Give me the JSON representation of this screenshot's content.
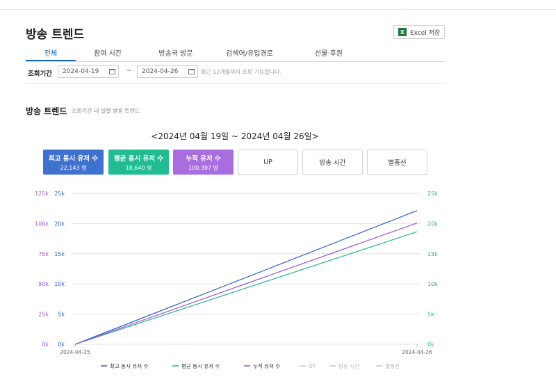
{
  "header": {
    "title": "방송 트렌드",
    "excel_label": "Excel 저장",
    "excel_icon": "excel-icon"
  },
  "tabs": [
    {
      "label": "전체",
      "active": true
    },
    {
      "label": "참여 시간",
      "active": false
    },
    {
      "label": "방송국 방문",
      "active": false
    },
    {
      "label": "검색어/유입경로",
      "active": false
    },
    {
      "label": "선물·후원",
      "active": false
    }
  ],
  "filter": {
    "label": "조회기간",
    "start_date": "2024-04-19",
    "end_date": "2024-04-26",
    "separator": "~",
    "note": "최근 12개월까지 조회 가능합니다."
  },
  "section": {
    "title": "방송 트렌드",
    "subtitle": "조회기간 내 일별 방송 트렌드",
    "range_label": "<2024년 04월 19일 ~ 2024년 04월 26일>"
  },
  "metrics": [
    {
      "label": "최고 동시 유저 수",
      "value": "22,143 명",
      "color": "#3f72cf",
      "style": "filled"
    },
    {
      "label": "평균 동시 유저 수",
      "value": "18,640 명",
      "color": "#22bc93",
      "style": "filled"
    },
    {
      "label": "누적 유저 수",
      "value": "100,397 명",
      "color": "#a86ee0",
      "style": "filled"
    },
    {
      "label": "UP",
      "value": "",
      "style": "outline"
    },
    {
      "label": "방송 시간",
      "value": "",
      "style": "outline"
    },
    {
      "label": "별풍선",
      "value": "",
      "style": "outline"
    }
  ],
  "chart_data": {
    "type": "line",
    "x": [
      "2024-04-25",
      "2024-04-26"
    ],
    "series": [
      {
        "name": "최고 동시 유저 수",
        "values": [
          0,
          22143
        ],
        "color": "#2d5fcc",
        "axis": "left-inner"
      },
      {
        "name": "평균 동시 유저 수",
        "values": [
          0,
          18640
        ],
        "color": "#1fb58f",
        "axis": "right"
      },
      {
        "name": "누적 유저 수",
        "values": [
          0,
          100397
        ],
        "color": "#9a55d6",
        "axis": "left-outer"
      }
    ],
    "inactive_series": [
      "UP",
      "방송 시간",
      "별풍선"
    ],
    "axes": {
      "left_outer": {
        "ticks": [
          "0k",
          "25k",
          "50k",
          "75k",
          "100k",
          "125k"
        ],
        "ylim": [
          0,
          125000
        ],
        "color": "#9a55d6"
      },
      "left_inner": {
        "ticks": [
          "0k",
          "5k",
          "10k",
          "15k",
          "20k",
          "25k"
        ],
        "ylim": [
          0,
          25000
        ],
        "color": "#2d5fcc"
      },
      "right": {
        "ticks": [
          "0k",
          "5k",
          "10k",
          "15k",
          "20k",
          "25k"
        ],
        "ylim": [
          0,
          25000
        ],
        "color": "#1fb58f"
      }
    },
    "grid": true,
    "legend_position": "bottom"
  }
}
